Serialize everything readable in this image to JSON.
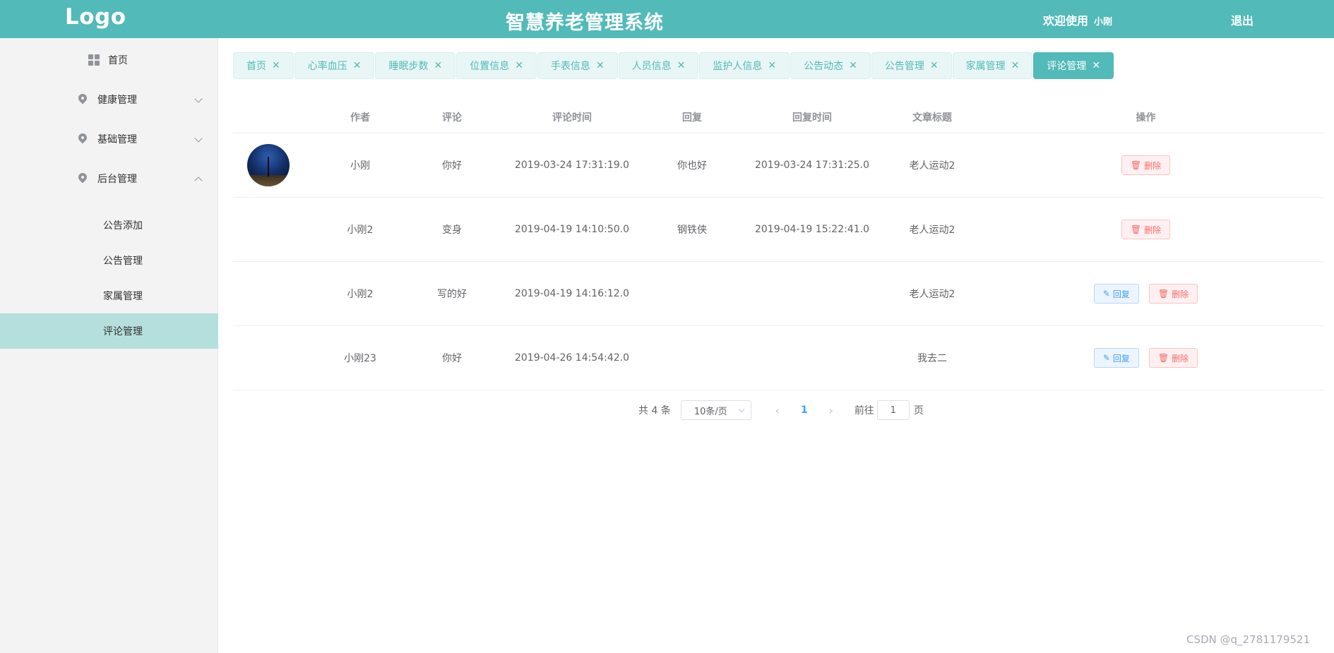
{
  "header": {
    "logo": "Logo",
    "title": "智慧养老管理系统",
    "welcome": "欢迎使用",
    "username": "小刚",
    "logout": "退出"
  },
  "sidebar": {
    "home": "首页",
    "groups": [
      {
        "label": "健康管理",
        "expanded": false
      },
      {
        "label": "基础管理",
        "expanded": false
      },
      {
        "label": "后台管理",
        "expanded": true
      }
    ],
    "subitems": [
      "公告添加",
      "公告管理",
      "家属管理",
      "评论管理"
    ],
    "active_subitem": "评论管理"
  },
  "tabs": [
    {
      "label": "首页"
    },
    {
      "label": "心率血压"
    },
    {
      "label": "睡眠步数"
    },
    {
      "label": "位置信息"
    },
    {
      "label": "手表信息"
    },
    {
      "label": "人员信息"
    },
    {
      "label": "监护人信息"
    },
    {
      "label": "公告动态"
    },
    {
      "label": "公告管理"
    },
    {
      "label": "家属管理"
    },
    {
      "label": "评论管理",
      "active": true
    }
  ],
  "table": {
    "columns": [
      "作者",
      "评论",
      "评论时间",
      "回复",
      "回复时间",
      "文章标题",
      "操作"
    ],
    "rows": [
      {
        "author": "小刚",
        "comment": "你好",
        "comment_time": "2019-03-24 17:31:19.0",
        "reply": "你也好",
        "reply_time": "2019-03-24 17:31:25.0",
        "article": "老人运动2",
        "has_avatar": true
      },
      {
        "author": "小刚2",
        "comment": "变身",
        "comment_time": "2019-04-19 14:10:50.0",
        "reply": "钢铁侠",
        "reply_time": "2019-04-19 15:22:41.0",
        "article": "老人运动2",
        "has_avatar": false
      },
      {
        "author": "小刚2",
        "comment": "写的好",
        "comment_time": "2019-04-19 14:16:12.0",
        "reply": "",
        "reply_time": "",
        "article": "老人运动2",
        "has_avatar": false
      },
      {
        "author": "小刚23",
        "comment": "你好",
        "comment_time": "2019-04-26 14:54:42.0",
        "reply": "",
        "reply_time": "",
        "article": "我去二",
        "has_avatar": false
      }
    ],
    "actions": {
      "delete": "删除",
      "reply": "回复"
    }
  },
  "pagination": {
    "total": "共 4 条",
    "page_size": "10条/页",
    "current_page": "1",
    "goto_prefix": "前往",
    "goto_value": "1",
    "goto_suffix": "页"
  },
  "watermark": "CSDN @q_2781179521",
  "colors": {
    "primary": "#52bab8",
    "active_menu_bg": "#b5dfdd",
    "danger": "#f56c6c",
    "info": "#409eff"
  }
}
